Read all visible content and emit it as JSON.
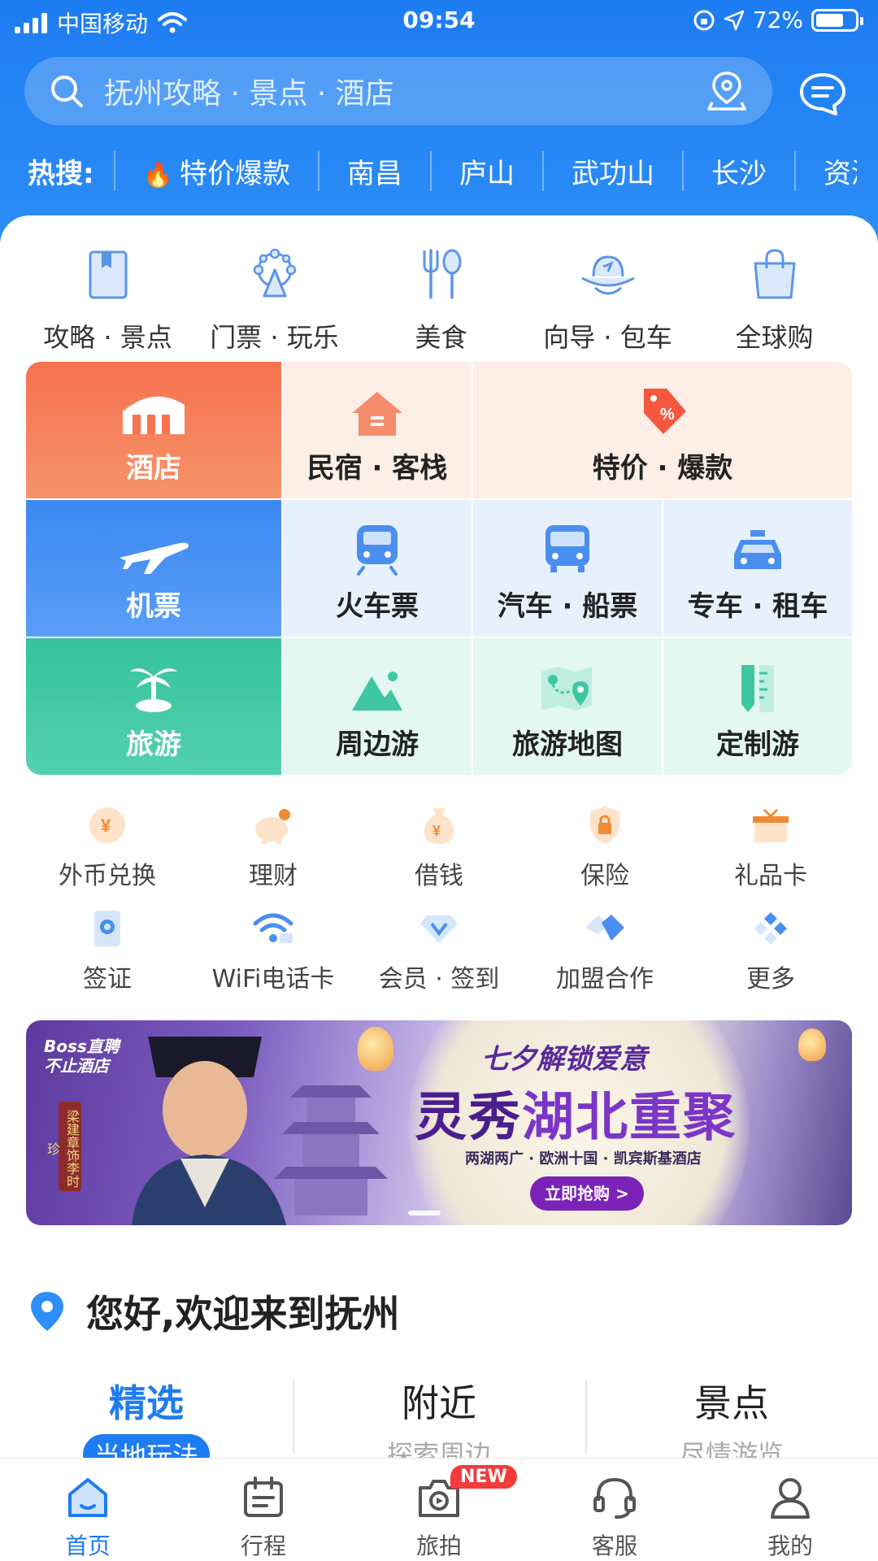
{
  "status_bar": {
    "carrier": "中国移动",
    "time": "09:54",
    "battery": "72%"
  },
  "search": {
    "placeholder": "抚州攻略 · 景点 · 酒店"
  },
  "hot_search": {
    "label": "热搜:",
    "items": [
      "特价爆款",
      "南昌",
      "庐山",
      "武功山",
      "长沙",
      "资溪"
    ]
  },
  "top_nav": [
    {
      "label": "攻略 · 景点",
      "icon": "guide-book-icon"
    },
    {
      "label": "门票 · 玩乐",
      "icon": "ferris-wheel-icon"
    },
    {
      "label": "美食",
      "icon": "fork-spoon-icon"
    },
    {
      "label": "向导 · 包车",
      "icon": "guide-hat-icon"
    },
    {
      "label": "全球购",
      "icon": "shopping-bag-icon"
    }
  ],
  "grid": {
    "hotel": "酒店",
    "homestay": "民宿 · 客栈",
    "deals": "特价 · 爆款",
    "flight": "机票",
    "train": "火车票",
    "bus_ship": "汽车 · 船票",
    "car_rental": "专车 · 租车",
    "travel": "旅游",
    "nearby_tour": "周边游",
    "travel_map": "旅游地图",
    "custom_tour": "定制游"
  },
  "services_row1": [
    {
      "label": "外币兑换",
      "icon": "yen-coin-icon"
    },
    {
      "label": "理财",
      "icon": "piggy-bank-icon"
    },
    {
      "label": "借钱",
      "icon": "money-bag-icon"
    },
    {
      "label": "保险",
      "icon": "shield-lock-icon"
    },
    {
      "label": "礼品卡",
      "icon": "gift-icon"
    }
  ],
  "services_row2": [
    {
      "label": "签证",
      "icon": "passport-icon"
    },
    {
      "label": "WiFi电话卡",
      "icon": "wifi-icon"
    },
    {
      "label": "会员 · 签到",
      "icon": "diamond-icon"
    },
    {
      "label": "加盟合作",
      "icon": "handshake-icon"
    },
    {
      "label": "更多",
      "icon": "more-grid-icon"
    }
  ],
  "banner": {
    "brand_line1": "Boss直聘",
    "brand_line2": "不止酒店",
    "vertical_text": "梁建章饰李时珍",
    "subtitle": "七夕解锁爱意",
    "headline_part1": "灵秀",
    "headline_part2": "湖北重聚",
    "tagline": "两湖两广 · 欧洲十国 · 凯宾斯基酒店",
    "cta": "立即抢购 >"
  },
  "greeting": "您好,欢迎来到抚州",
  "tabs": [
    {
      "title": "精选",
      "subtitle": "当地玩法"
    },
    {
      "title": "附近",
      "subtitle": "探索周边"
    },
    {
      "title": "景点",
      "subtitle": "尽情游览"
    }
  ],
  "bottom_nav": [
    {
      "label": "首页",
      "icon": "home-icon"
    },
    {
      "label": "行程",
      "icon": "calendar-icon"
    },
    {
      "label": "旅拍",
      "icon": "camera-icon",
      "badge": "NEW"
    },
    {
      "label": "客服",
      "icon": "headset-icon"
    },
    {
      "label": "我的",
      "icon": "user-icon"
    }
  ],
  "colors": {
    "primary": "#1e7cf2",
    "hotel": "#f26a4f",
    "flight": "#3d8ef5",
    "travel": "#3ec7a4"
  }
}
